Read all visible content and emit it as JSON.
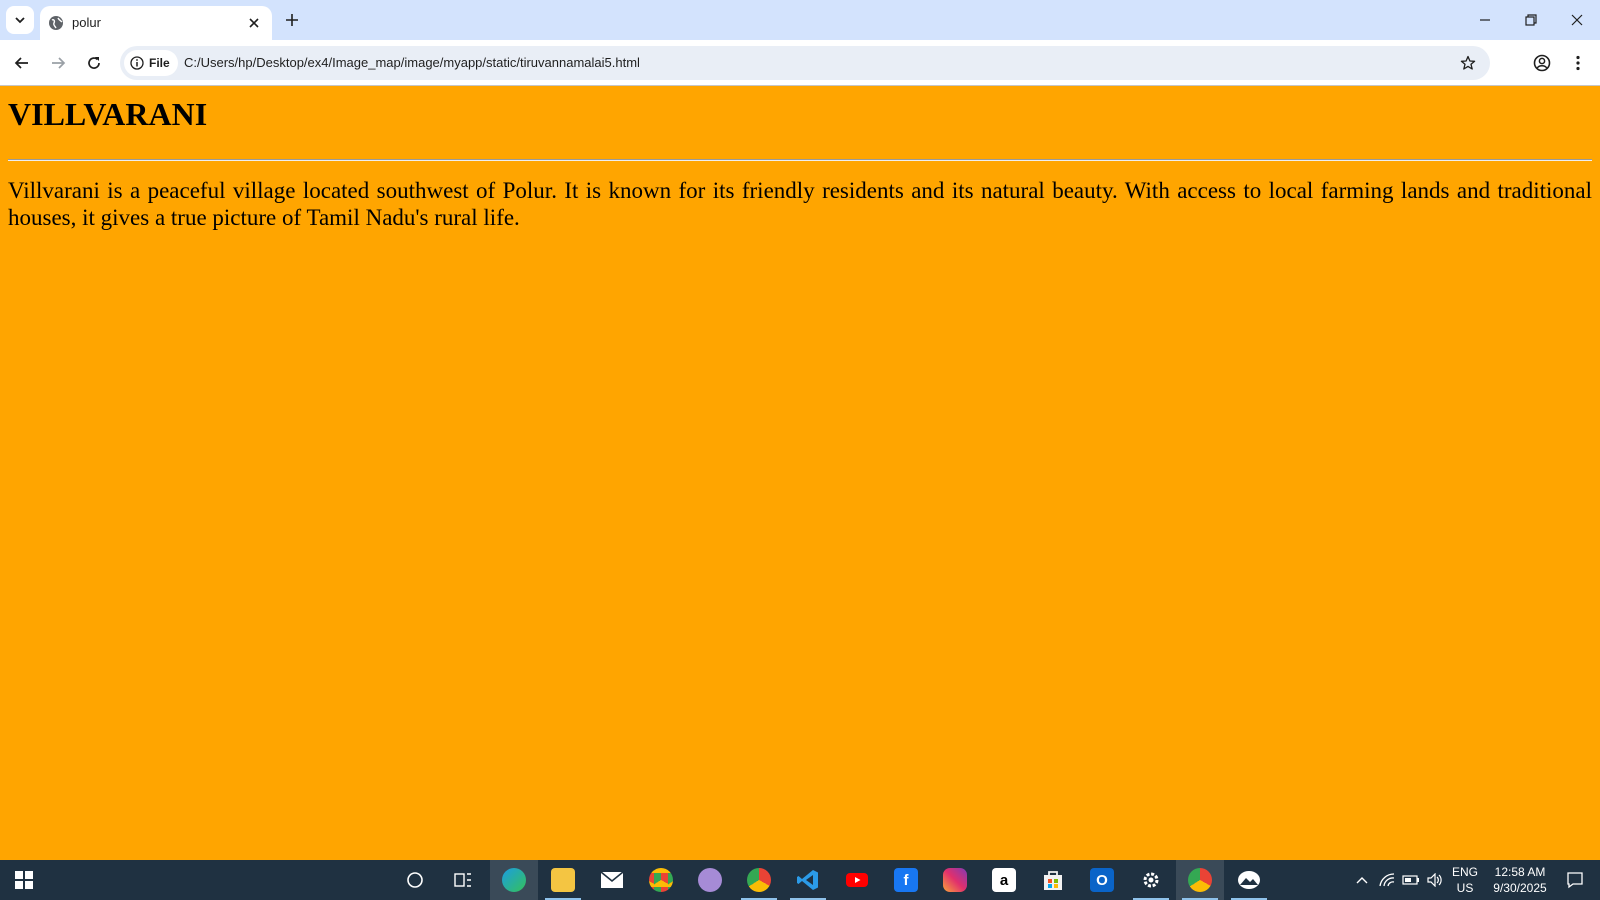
{
  "browser": {
    "tab": {
      "title": "polur"
    },
    "address": {
      "chip_label": "File",
      "url": "C:/Users/hp/Desktop/ex4/Image_map/image/myapp/static/tiruvannamalai5.html"
    }
  },
  "page": {
    "heading": "VILLVARANI",
    "paragraph": "Villvarani is a peaceful village located southwest of Polur. It is known for its friendly residents and its natural beauty. With access to local farming lands and traditional houses, it gives a true picture of Tamil Nadu's rural life.",
    "background_color": "#ffa500"
  },
  "taskbar": {
    "apps": [
      {
        "name": "edge-icon",
        "active": true
      },
      {
        "name": "file-explorer-icon",
        "running": true
      },
      {
        "name": "mail-icon"
      },
      {
        "name": "chrome-icon"
      },
      {
        "name": "chrome-profile-icon"
      },
      {
        "name": "chrome-t-icon",
        "running": true
      },
      {
        "name": "vscode-icon",
        "running": true
      },
      {
        "name": "youtube-icon"
      },
      {
        "name": "facebook-icon"
      },
      {
        "name": "instagram-icon"
      },
      {
        "name": "amazon-icon",
        "label": "a"
      },
      {
        "name": "store-icon"
      },
      {
        "name": "outlook-icon",
        "label": "O"
      },
      {
        "name": "settings-icon",
        "running": true
      },
      {
        "name": "chrome-active-icon",
        "active": true,
        "running": true
      },
      {
        "name": "photos-icon",
        "running": true
      }
    ],
    "tray": {
      "lang_top": "ENG",
      "lang_bottom": "US",
      "time": "12:58 AM",
      "date": "9/30/2025"
    }
  }
}
